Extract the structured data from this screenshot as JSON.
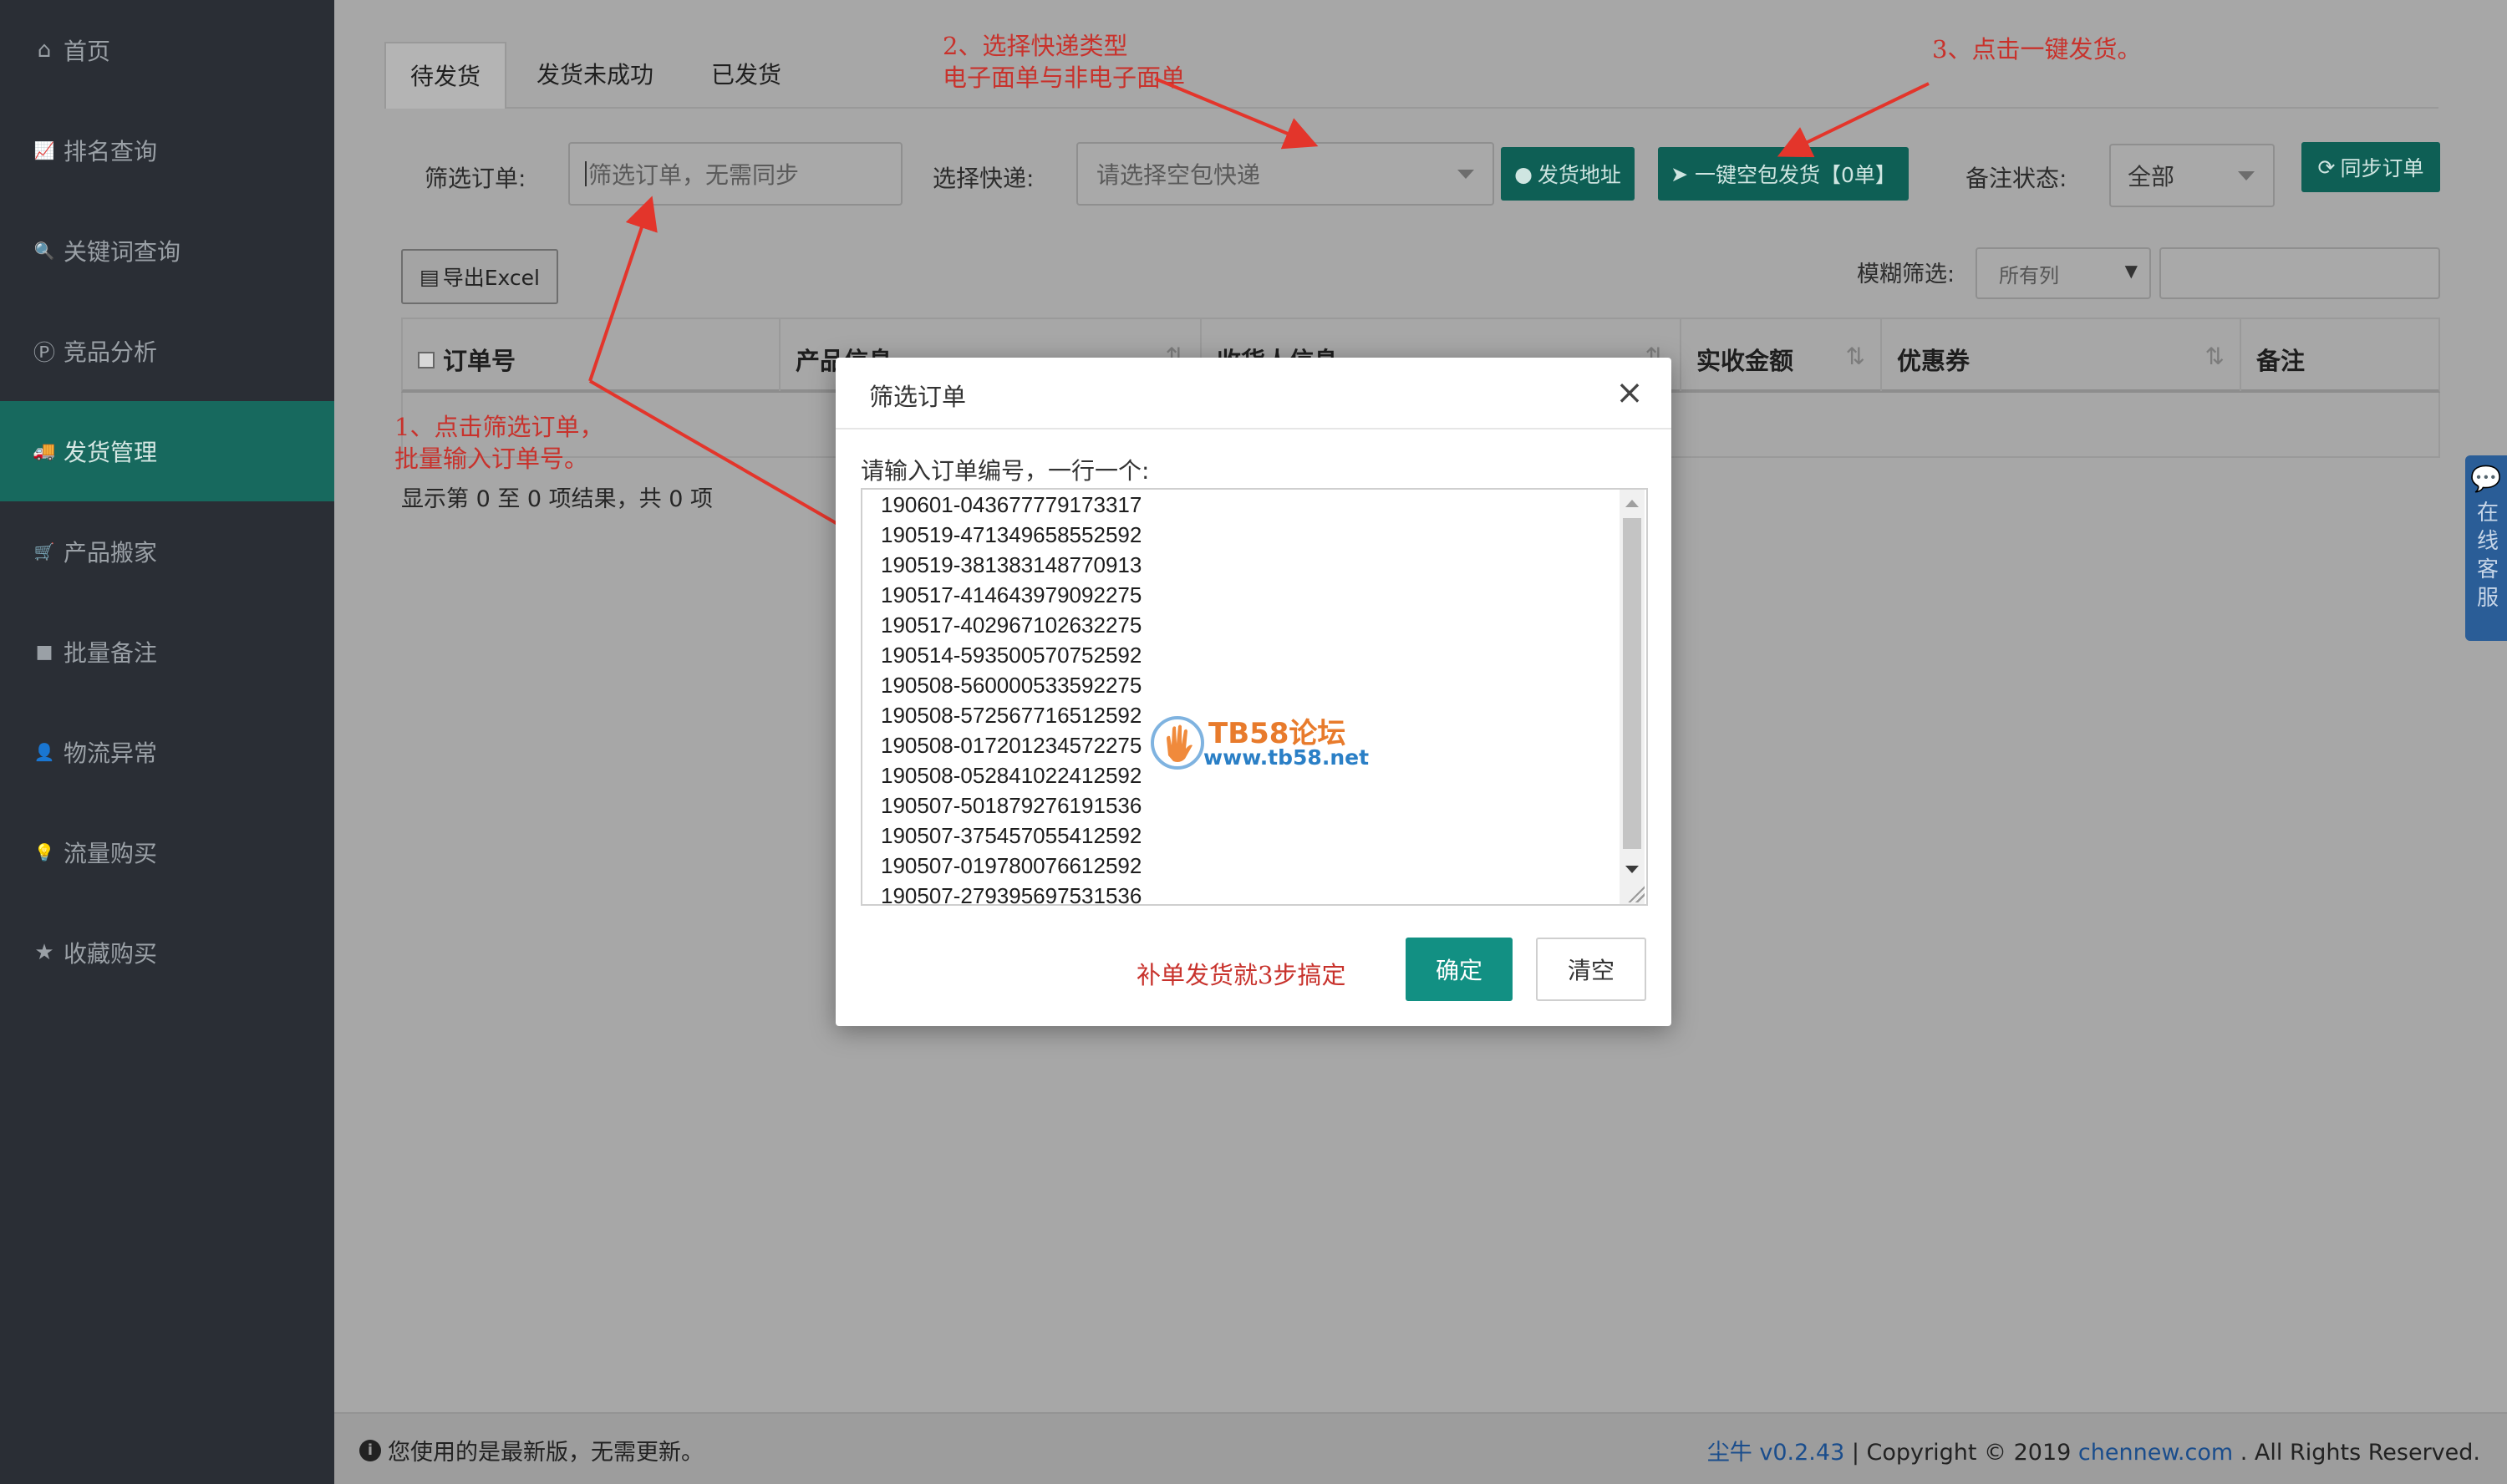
{
  "sidebar": {
    "items": [
      {
        "label": "首页",
        "icon": "home-icon",
        "glyph": "⌂"
      },
      {
        "label": "排名查询",
        "icon": "chart-icon",
        "glyph": "📈"
      },
      {
        "label": "关键词查询",
        "icon": "search-icon",
        "glyph": "🔍"
      },
      {
        "label": "竞品分析",
        "icon": "p-badge-icon",
        "glyph": "Ⓟ"
      },
      {
        "label": "发货管理",
        "icon": "truck-icon",
        "glyph": "🚚",
        "active": true
      },
      {
        "label": "产品搬家",
        "icon": "cart-icon",
        "glyph": "🛒"
      },
      {
        "label": "批量备注",
        "icon": "note-icon",
        "glyph": "■"
      },
      {
        "label": "物流异常",
        "icon": "person-icon",
        "glyph": "👤"
      },
      {
        "label": "流量购买",
        "icon": "bulb-icon",
        "glyph": "💡"
      },
      {
        "label": "收藏购买",
        "icon": "star-icon",
        "glyph": "★"
      }
    ]
  },
  "tabs": [
    "待发货",
    "发货未成功",
    "已发货"
  ],
  "filter": {
    "order_label": "筛选订单:",
    "order_placeholder": "筛选订单，无需同步",
    "express_label": "选择快递:",
    "express_placeholder": "请选择空包快递",
    "address_button": "发货地址",
    "ship_button": "一键空包发货【0单】",
    "remark_label": "备注状态:",
    "remark_value": "全部",
    "sync_button": "同步订单"
  },
  "toolbar": {
    "export_button": "导出Excel",
    "fuzzy_label": "模糊筛选:",
    "fuzzy_select": "所有列"
  },
  "table": {
    "columns": [
      "订单号",
      "产品信息",
      "收货人信息",
      "实收金额",
      "优惠券",
      "备注"
    ],
    "showing": "显示第 0 至 0 项结果，共 0 项"
  },
  "footer": {
    "status": "您使用的是最新版，无需更新。",
    "app_link": "尘牛 v0.2.43",
    "copyright": " | Copyright © 2019 ",
    "site_link": "chennew.com",
    "rights": " . All Rights Reserved."
  },
  "chat_widget": {
    "label": "在线客服"
  },
  "annotations": {
    "step1_line1": "1、点击筛选订单，",
    "step1_line2": "批量输入订单号。",
    "step2_line1": "2、选择快递类型",
    "step2_line2": "电子面单与非电子面单",
    "step3": "3、点击一键发货。",
    "color": "#c8322c"
  },
  "modal": {
    "title": "筛选订单",
    "prompt": "请输入订单编号，一行一个:",
    "orders": [
      "190601-043677779173317",
      "190519-471349658552592",
      "190519-381383148770913",
      "190517-414643979092275",
      "190517-402967102632275",
      "190514-593500570752592",
      "190508-560000533592275",
      "190508-572567716512592",
      "190508-017201234572275",
      "190508-052841022412592",
      "190507-501879276191536",
      "190507-375457055412592",
      "190507-019780076612592",
      "190507-279395697531536"
    ],
    "hint": "补单发货就3步搞定",
    "ok_button": "确定",
    "clear_button": "清空"
  },
  "watermark": {
    "title": "TB58论坛",
    "url": "www.tb58.net"
  },
  "colors": {
    "sidebar_bg": "#2a2e35",
    "active_bg": "#17695e",
    "accent": "#129083",
    "overlay_bg": "#a7a7a7"
  }
}
